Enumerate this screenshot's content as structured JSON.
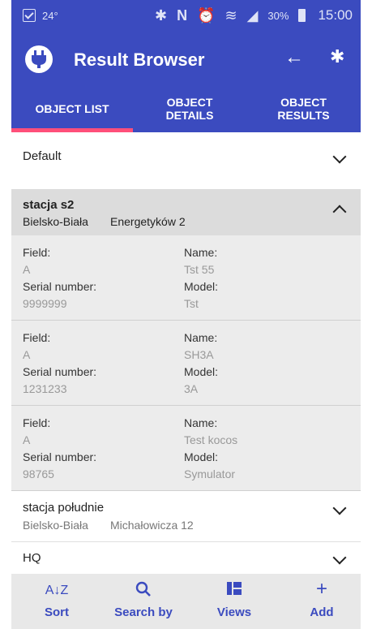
{
  "statusbar": {
    "notif": "24°",
    "battery": "30%",
    "time": "15:00"
  },
  "appbar": {
    "title": "Result Browser"
  },
  "tabs": [
    {
      "label_line1": "OBJECT LIST",
      "label_line2": ""
    },
    {
      "label_line1": "OBJECT",
      "label_line2": "DETAILS"
    },
    {
      "label_line1": "OBJECT",
      "label_line2": "RESULTS"
    }
  ],
  "groups": {
    "default": {
      "name": "Default"
    },
    "s2": {
      "name": "stacja s2",
      "city": "Bielsko-Biała",
      "street": "Energetyków 2"
    },
    "south": {
      "name": "stacja południe",
      "city": "Bielsko-Biała",
      "street": "Michałowicza 12"
    },
    "hq": {
      "name": "HQ"
    }
  },
  "labels": {
    "field": "Field:",
    "name": "Name:",
    "serial": "Serial number:",
    "model": "Model:"
  },
  "objects": [
    {
      "field": "A",
      "name": "Tst 55",
      "serial": "9999999",
      "model": "Tst"
    },
    {
      "field": "A",
      "name": "SH3A",
      "serial": "1231233",
      "model": "3A"
    },
    {
      "field": "A",
      "name": "Test kocos",
      "serial": "98765",
      "model": "Symulator"
    }
  ],
  "bottom_nav": {
    "sort": "Sort",
    "search": "Search by",
    "views": "Views",
    "add": "Add",
    "sort_icon": "A↓Z"
  },
  "colors": {
    "primary": "#3b4bbf",
    "accent": "#ff4f7a"
  }
}
